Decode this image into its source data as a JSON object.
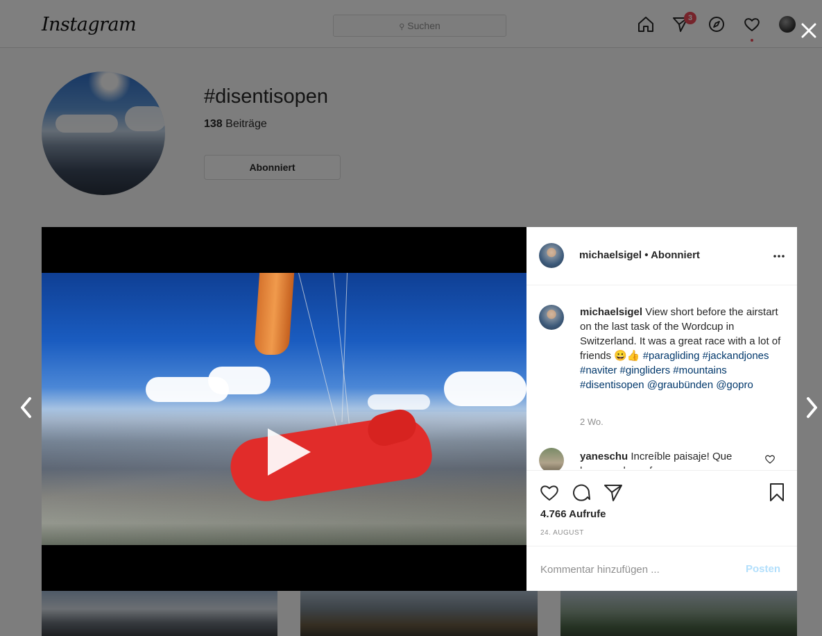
{
  "topbar": {
    "logo": "Instagram",
    "search_placeholder": "Suchen",
    "direct_badge": "3"
  },
  "hashtag": {
    "title": "#disentisopen",
    "posts_count": "138",
    "posts_label": " Beiträge",
    "follow_label": "Abonniert"
  },
  "post": {
    "header": {
      "username": "michaelsigel",
      "follow_state": " • Abonniert"
    },
    "caption": {
      "username": "michaelsigel",
      "text": " View short before the airstart on the last task of the Wordcup in Switzerland. It was a great race with a lot of friends 😀👍 ",
      "tags": "#paragliding #jackandjones #naviter #gingliders #mountains #disentisopen @graubünden @gopro",
      "time": "2 Wo."
    },
    "comment": {
      "username": "yaneschu",
      "text": " Increíble paisaje! Que hermoso lugar fue"
    },
    "views": "4.766 Aufrufe",
    "date": "24. AUGUST",
    "add_comment_placeholder": "Kommentar hinzufügen ...",
    "post_button": "Posten"
  },
  "colors": {
    "notification_red": "#ed4956",
    "hashtag_link": "#00376b",
    "post_button_disabled": "#b2dffc"
  }
}
